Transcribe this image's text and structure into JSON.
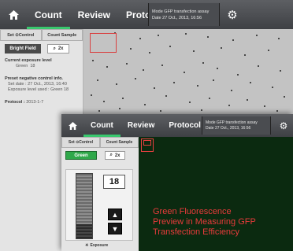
{
  "back": {
    "nav": {
      "tabs": [
        "Count",
        "Review",
        "Protocol"
      ],
      "active_tab": "Count"
    },
    "mode": {
      "mode_label": "Mode",
      "mode_value": "GFP transfection assay",
      "date_label": "Date",
      "date_value": "27 Oct., 2013, 16:56"
    },
    "subtabs": [
      "Set ⊙Control",
      "Count Sample"
    ],
    "bright_field_label": "Bright Field",
    "magnification": "2x",
    "exposure_title": "Current exposure level",
    "exposure_channel": "Green",
    "exposure_value": "18",
    "preset_title": "Preset negative control info.",
    "preset_date": "Set date : 27 Oct., 2013, 16:40",
    "preset_exposure": "Exposure level used : Green 18",
    "protocol_label": "Protocol :",
    "protocol_value": "2013-1-7"
  },
  "front": {
    "nav": {
      "tabs": [
        "Count",
        "Review",
        "Protocol"
      ],
      "active_tab": "Count"
    },
    "mode": {
      "mode_label": "Mode",
      "mode_value": "GFP transfection assay",
      "date_label": "Date",
      "date_value": "27 Oct., 2013, 16:56"
    },
    "subtabs": [
      "Set ⊙Control",
      "Count Sample"
    ],
    "channel_label": "Green",
    "magnification": "2x",
    "exposure_value": "18",
    "exposure_level_fraction": 0.22,
    "exposure_label": "Exposure",
    "up_arrow": "▲",
    "down_arrow": "▼"
  },
  "caption": {
    "line1": "Green Fluorescence",
    "line2": "Preview in Measuring  GFP",
    "line3": "Transfection Efficiency"
  },
  "colors": {
    "accent_green": "#39c86e",
    "roi_red": "#d94040",
    "caption_red": "#e93b3b"
  }
}
